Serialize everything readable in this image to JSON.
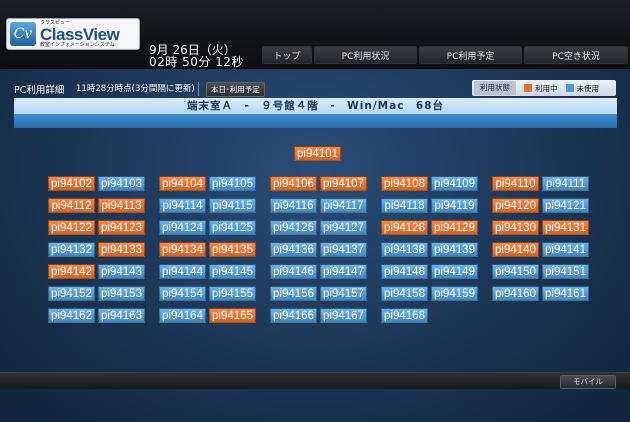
{
  "header": {
    "logo_ruby": "クラスビュー",
    "logo_name": "ClassView",
    "logo_sub": "教室インフォメーションシステム",
    "date": "9月 26日（火）",
    "time": "02時 50分 12秒"
  },
  "nav": [
    {
      "label": "トップ"
    },
    {
      "label": "PC利用状況"
    },
    {
      "label": "PC利用予定"
    },
    {
      "label": "PC空き状況"
    }
  ],
  "subbar": {
    "title": "PC利用詳細",
    "update": "11時28分時点(3分間隔に更新)",
    "today_button": "本日･利用予定"
  },
  "legend": {
    "label": "利用状態",
    "in_use": "利用中",
    "unused": "未使用"
  },
  "colors": {
    "in_use": "#e2702f",
    "unused": "#4f98d5"
  },
  "room": {
    "title": "端末室Ａ　-　９号館４階　-　Win/Mac　68台"
  },
  "pcs": [
    {
      "name": "pi94101",
      "status": "in_use"
    },
    {
      "name": "pi94102",
      "status": "in_use"
    },
    {
      "name": "pi94103",
      "status": "unused"
    },
    {
      "name": "pi94104",
      "status": "in_use"
    },
    {
      "name": "pi94105",
      "status": "unused"
    },
    {
      "name": "pi94106",
      "status": "in_use"
    },
    {
      "name": "pi94107",
      "status": "in_use"
    },
    {
      "name": "pi94108",
      "status": "in_use"
    },
    {
      "name": "pi94109",
      "status": "unused"
    },
    {
      "name": "pi94110",
      "status": "in_use"
    },
    {
      "name": "pi94111",
      "status": "unused"
    },
    {
      "name": "pi94112",
      "status": "in_use"
    },
    {
      "name": "pi94113",
      "status": "in_use"
    },
    {
      "name": "pi94114",
      "status": "unused"
    },
    {
      "name": "pi94115",
      "status": "unused"
    },
    {
      "name": "pi94116",
      "status": "unused"
    },
    {
      "name": "pi94117",
      "status": "unused"
    },
    {
      "name": "pi94118",
      "status": "unused"
    },
    {
      "name": "pi94119",
      "status": "unused"
    },
    {
      "name": "pi94120",
      "status": "in_use"
    },
    {
      "name": "pi94121",
      "status": "unused"
    },
    {
      "name": "pi94122",
      "status": "in_use"
    },
    {
      "name": "pi94123",
      "status": "in_use"
    },
    {
      "name": "pi94124",
      "status": "unused"
    },
    {
      "name": "pi94125",
      "status": "unused"
    },
    {
      "name": "pi94126",
      "status": "unused"
    },
    {
      "name": "pi94127",
      "status": "unused"
    },
    {
      "name": "pi94128",
      "status": "in_use"
    },
    {
      "name": "pi94129",
      "status": "in_use"
    },
    {
      "name": "pi94130",
      "status": "in_use"
    },
    {
      "name": "pi94131",
      "status": "in_use"
    },
    {
      "name": "pi94132",
      "status": "unused"
    },
    {
      "name": "pi94133",
      "status": "in_use"
    },
    {
      "name": "pi94134",
      "status": "in_use"
    },
    {
      "name": "pi94135",
      "status": "in_use"
    },
    {
      "name": "pi94136",
      "status": "unused"
    },
    {
      "name": "pi94137",
      "status": "unused"
    },
    {
      "name": "pi94138",
      "status": "unused"
    },
    {
      "name": "pi94139",
      "status": "unused"
    },
    {
      "name": "pi94140",
      "status": "in_use"
    },
    {
      "name": "pi94141",
      "status": "unused"
    },
    {
      "name": "pi94142",
      "status": "in_use"
    },
    {
      "name": "pi94143",
      "status": "unused"
    },
    {
      "name": "pi94144",
      "status": "unused"
    },
    {
      "name": "pi94145",
      "status": "unused"
    },
    {
      "name": "pi94146",
      "status": "unused"
    },
    {
      "name": "pi94147",
      "status": "unused"
    },
    {
      "name": "pi94148",
      "status": "unused"
    },
    {
      "name": "pi94149",
      "status": "unused"
    },
    {
      "name": "pi94150",
      "status": "unused"
    },
    {
      "name": "pi94151",
      "status": "unused"
    },
    {
      "name": "pi94152",
      "status": "unused"
    },
    {
      "name": "pi94153",
      "status": "unused"
    },
    {
      "name": "pi94154",
      "status": "unused"
    },
    {
      "name": "pi94155",
      "status": "unused"
    },
    {
      "name": "pi94156",
      "status": "unused"
    },
    {
      "name": "pi94157",
      "status": "unused"
    },
    {
      "name": "pi94158",
      "status": "unused"
    },
    {
      "name": "pi94159",
      "status": "unused"
    },
    {
      "name": "pi94160",
      "status": "unused"
    },
    {
      "name": "pi94161",
      "status": "unused"
    },
    {
      "name": "pi94162",
      "status": "unused"
    },
    {
      "name": "pi94163",
      "status": "unused"
    },
    {
      "name": "pi94164",
      "status": "unused"
    },
    {
      "name": "pi94165",
      "status": "in_use"
    },
    {
      "name": "pi94166",
      "status": "unused"
    },
    {
      "name": "pi94167",
      "status": "unused"
    },
    {
      "name": "pi94168",
      "status": "unused"
    }
  ],
  "footer": {
    "mobile_button": "モバイル"
  }
}
